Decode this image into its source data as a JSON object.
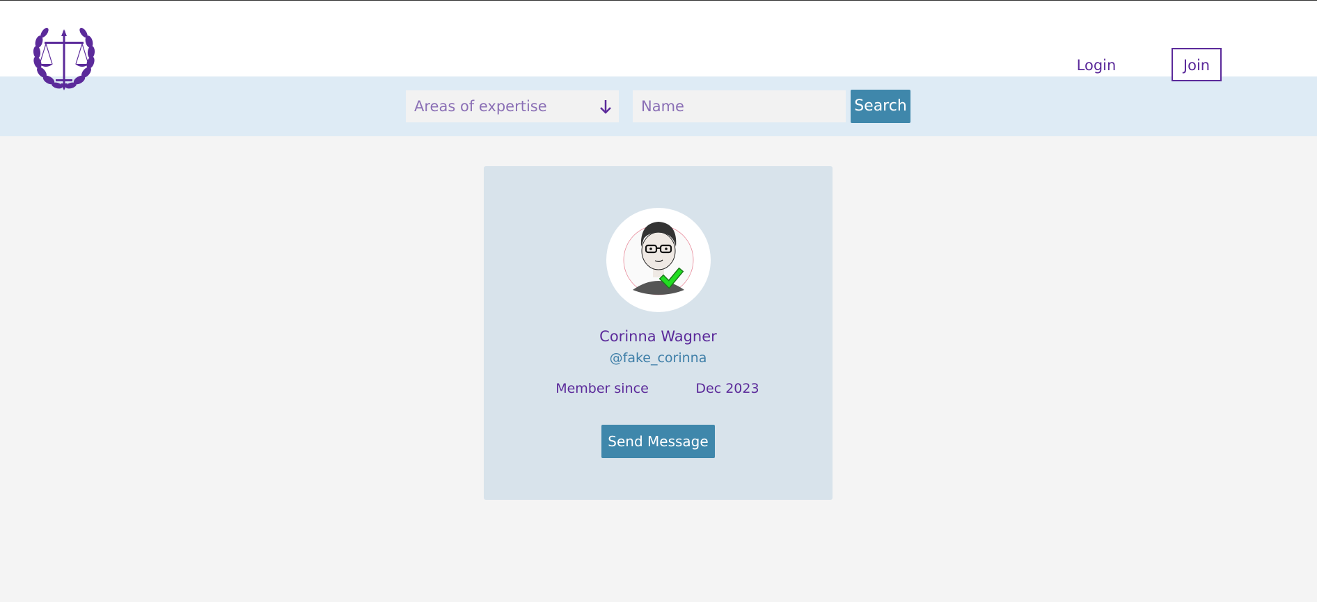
{
  "header": {
    "logo": "scales-of-justice-laurel-logo",
    "nav": {
      "login_label": "Login",
      "join_label": "Join"
    }
  },
  "search": {
    "expertise_placeholder": "Areas of expertise",
    "expertise_icon": "arrow-down-icon",
    "name_placeholder": "Name",
    "search_label": "Search"
  },
  "profile": {
    "avatar": "user-avatar-verified",
    "name": "Corinna Wagner",
    "handle": "@fake_corinna",
    "member_since_label": "Member since",
    "member_since_value": "Dec 2023",
    "send_message_label": "Send Message"
  },
  "colors": {
    "brand_purple": "#5b2a9a",
    "button_blue": "#3f87ab",
    "search_bar_bg": "#deebf5",
    "card_bg": "#d8e3eb",
    "page_bg": "#f4f4f4",
    "verified_green": "#22cc22"
  }
}
